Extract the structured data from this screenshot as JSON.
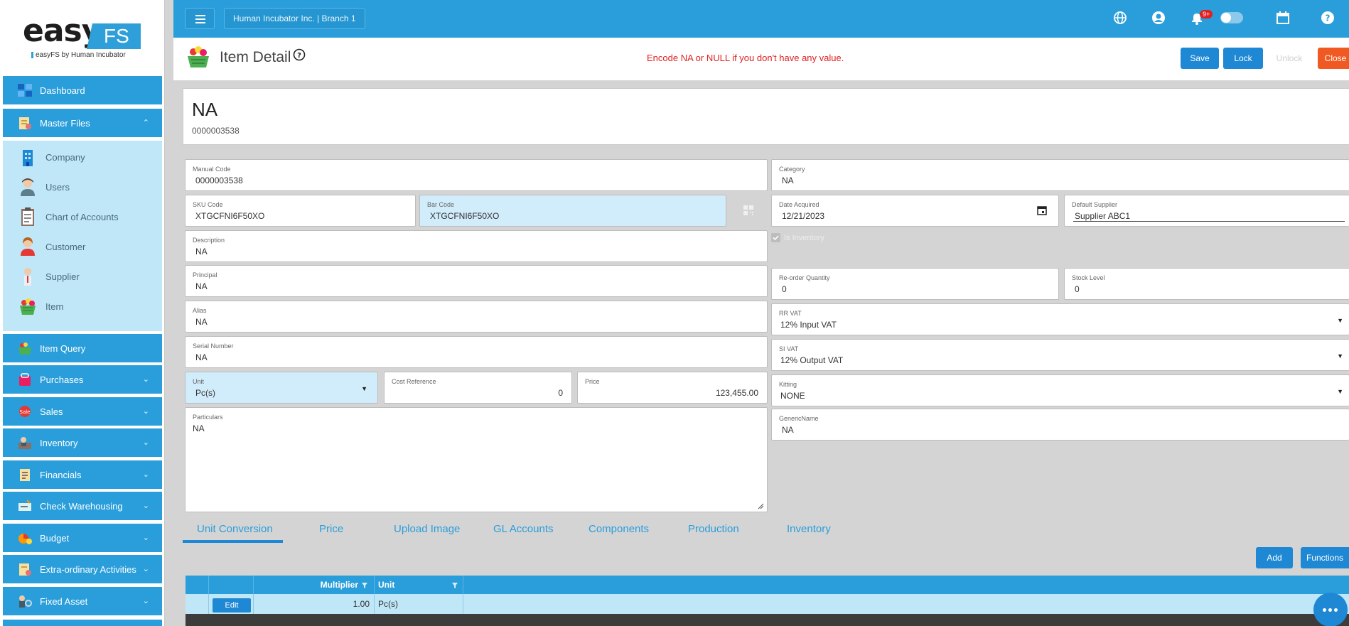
{
  "brand": {
    "word": "easy",
    "fs": "FS",
    "tagline": "easyFS by Human Incubator"
  },
  "sidebar": {
    "items": [
      {
        "label": "Dashboard"
      },
      {
        "label": "Master Files"
      },
      {
        "label": "Item Query"
      },
      {
        "label": "Purchases"
      },
      {
        "label": "Sales"
      },
      {
        "label": "Inventory"
      },
      {
        "label": "Financials"
      },
      {
        "label": "Check Warehousing"
      },
      {
        "label": "Budget"
      },
      {
        "label": "Extra-ordinary Activities"
      },
      {
        "label": "Fixed Asset"
      }
    ],
    "submenu": [
      {
        "label": "Company"
      },
      {
        "label": "Users"
      },
      {
        "label": "Chart of Accounts"
      },
      {
        "label": "Customer"
      },
      {
        "label": "Supplier"
      },
      {
        "label": "Item"
      }
    ]
  },
  "topbar": {
    "branch": "Human Incubator Inc. | Branch 1",
    "notif_badge": "9+"
  },
  "header": {
    "title": "Item Detail",
    "warning": "Encode NA or NULL if you don't have any value.",
    "save": "Save",
    "lock": "Lock",
    "unlock": "Unlock",
    "close": "Close"
  },
  "item": {
    "name": "NA",
    "code": "0000003538"
  },
  "fields": {
    "manual_code": {
      "label": "Manual Code",
      "value": "0000003538"
    },
    "sku_code": {
      "label": "SKU Code",
      "value": "XTGCFNI6F50XO"
    },
    "bar_code": {
      "label": "Bar Code",
      "value": "XTGCFNI6F50XO"
    },
    "description": {
      "label": "Description",
      "value": "NA"
    },
    "principal": {
      "label": "Principal",
      "value": "NA"
    },
    "alias": {
      "label": "Alias",
      "value": "NA"
    },
    "serial_number": {
      "label": "Serial Number",
      "value": "NA"
    },
    "unit": {
      "label": "Unit",
      "value": "Pc(s)"
    },
    "cost_reference": {
      "label": "Cost Reference",
      "value": "0"
    },
    "price": {
      "label": "Price",
      "value": "123,455.00"
    },
    "particulars": {
      "label": "Particulars",
      "value": "NA"
    },
    "category": {
      "label": "Category",
      "value": "NA"
    },
    "date_acquired": {
      "label": "Date Acquired",
      "value": "12/21/2023"
    },
    "default_supplier": {
      "label": "Default Supplier",
      "value": "Supplier ABC1"
    },
    "is_inventory": {
      "label": "Is Inventory"
    },
    "reorder_qty": {
      "label": "Re-order Quantity",
      "value": "0"
    },
    "stock_level": {
      "label": "Stock Level",
      "value": "0"
    },
    "rr_vat": {
      "label": "RR VAT",
      "value": "12% Input VAT"
    },
    "si_vat": {
      "label": "SI VAT",
      "value": "12% Output VAT"
    },
    "kitting": {
      "label": "Kitting",
      "value": "NONE"
    },
    "generic_name": {
      "label": "GenericName",
      "value": "NA"
    }
  },
  "tabs": [
    "Unit Conversion",
    "Price",
    "Upload Image",
    "GL Accounts",
    "Components",
    "Production",
    "Inventory"
  ],
  "actions": {
    "add": "Add",
    "functions": "Functions"
  },
  "grid": {
    "headers": {
      "multiplier": "Multiplier",
      "unit": "Unit"
    },
    "rows": [
      {
        "edit": "Edit",
        "multiplier": "1.00",
        "unit": "Pc(s)"
      }
    ]
  },
  "colors": {
    "primary": "#2a9edb",
    "button": "#1e88d4",
    "close": "#f05a22",
    "warning": "#e02020",
    "submenu_bg": "#bfe7f8"
  }
}
